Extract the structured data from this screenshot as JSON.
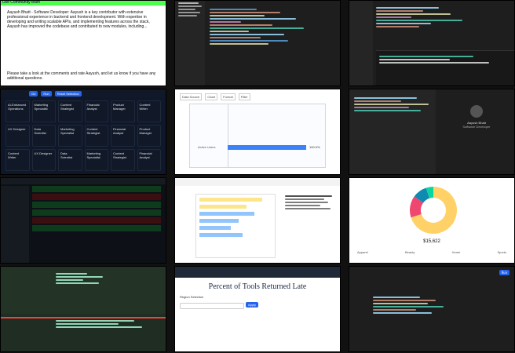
{
  "tiles": {
    "t1": {
      "tag": "Use Community team",
      "paragraph1": "Aayush Bhatt - Software Developer: Aayush is a key contributor with extensive professional experience in backend and frontend development. With expertise in developing and writing scalable APIs, and implementing features across the stack, Aayush has improved the codebase and contributed to new modules, including...",
      "paragraph2": "Please take a look at the comments and rate Aayush, and let us know if you have any additional questions."
    },
    "t4": {
      "top_buttons": [
        "Go",
        "Run",
        "Reset Selection"
      ],
      "cards": [
        "AI-Enhanced Operations",
        "Marketing Specialist",
        "Content Strategist",
        "Financial Analyst",
        "Product Manager",
        "Content Writer",
        "UX Designer",
        "Data Scientist",
        "Marketing Specialist",
        "Content Strategist",
        "Financial Analyst",
        "Product Manager",
        "Content Writer",
        "UX Designer",
        "Data Scientist",
        "Marketing Specialist",
        "Content Strategist",
        "Financial Analyst"
      ]
    },
    "t5": {
      "tabs": [
        "Data Source",
        "Chart",
        "Format",
        "Filter"
      ],
      "title": "",
      "bar_label": "100.0%",
      "bar_category": "Active Users"
    },
    "t6": {
      "user_name": "Aayush Bhatt",
      "sub": "Software Developer"
    },
    "t8": {
      "chart_data": {
        "type": "pie",
        "values": [
          70,
          15,
          10,
          5
        ],
        "colors": [
          "#ffd166",
          "#ef476f",
          "#118ab2",
          "#06d6a0"
        ]
      },
      "total": "$15,622",
      "legend": [
        "Apparel",
        "Beauty",
        "Home",
        "Sports"
      ]
    },
    "t11": {
      "title": "Percent of Tools Returned Late",
      "filter_label": "Region Selection",
      "button": "Apply"
    },
    "t12": {
      "button": "Run"
    }
  }
}
